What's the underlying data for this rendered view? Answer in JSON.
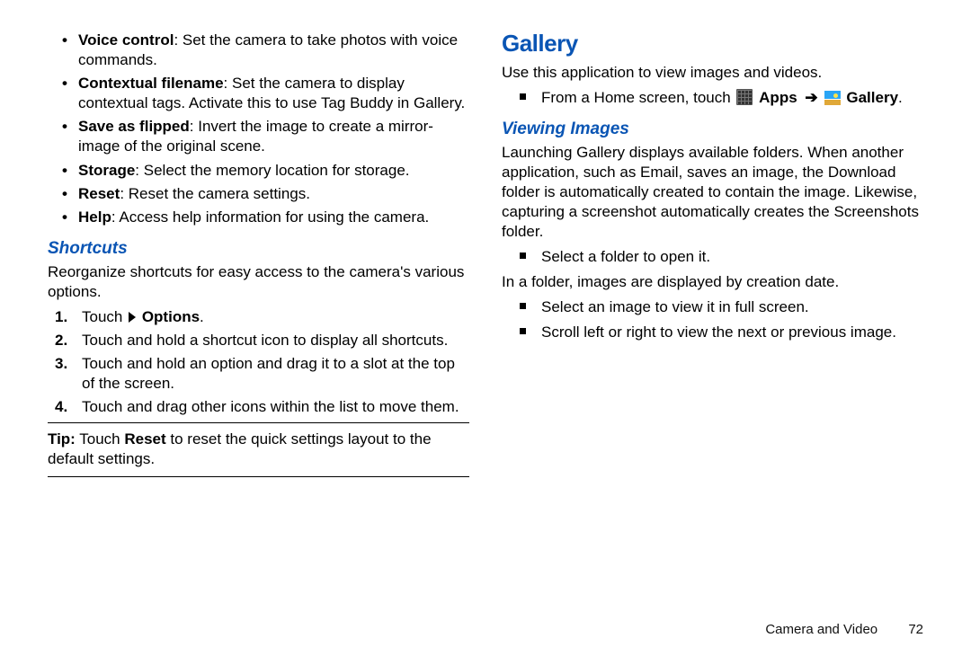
{
  "left": {
    "settings": [
      {
        "label": "Voice control",
        "desc": ": Set the camera to take photos with voice commands."
      },
      {
        "label": "Contextual filename",
        "desc": ": Set the camera to display contextual tags. Activate this to use Tag Buddy in Gallery."
      },
      {
        "label": "Save as flipped",
        "desc": ": Invert the image to create a mirror-image of the original scene."
      },
      {
        "label": "Storage",
        "desc": ": Select the memory location for storage."
      },
      {
        "label": "Reset",
        "desc": ": Reset the camera settings."
      },
      {
        "label": "Help",
        "desc": ": Access help information for using the camera."
      }
    ],
    "shortcuts_heading": "Shortcuts",
    "shortcuts_intro": "Reorganize shortcuts for easy access to the camera's various options.",
    "steps": {
      "s1_prefix": "Touch ",
      "s1_bold": "Options",
      "s1_suffix": ".",
      "s2": "Touch and hold a shortcut icon to display all shortcuts.",
      "s3": "Touch and hold an option and drag it to a slot at the top of the screen.",
      "s4": "Touch and drag other icons within the list to move them."
    },
    "tip_label": "Tip:",
    "tip_mid1": " Touch ",
    "tip_bold": "Reset",
    "tip_mid2": " to reset the quick settings layout to the default settings."
  },
  "right": {
    "gallery_heading": "Gallery",
    "gallery_intro": "Use this application to view images and videos.",
    "nav_prefix": "From a Home screen, touch ",
    "nav_apps": "Apps",
    "nav_gallery": "Gallery",
    "viewing_heading": "Viewing Images",
    "viewing_para": "Launching Gallery displays available folders. When another application, such as Email, saves an image, the Download folder is automatically created to contain the image. Likewise, capturing a screenshot automatically creates the Screenshots folder.",
    "sqA": "Select a folder to open it.",
    "midA": "In a folder, images are displayed by creation date.",
    "sqB": "Select an image to view it in full screen.",
    "sqC": "Scroll left or right to view the next or previous image."
  },
  "footer": {
    "section": "Camera and Video",
    "page": "72"
  }
}
